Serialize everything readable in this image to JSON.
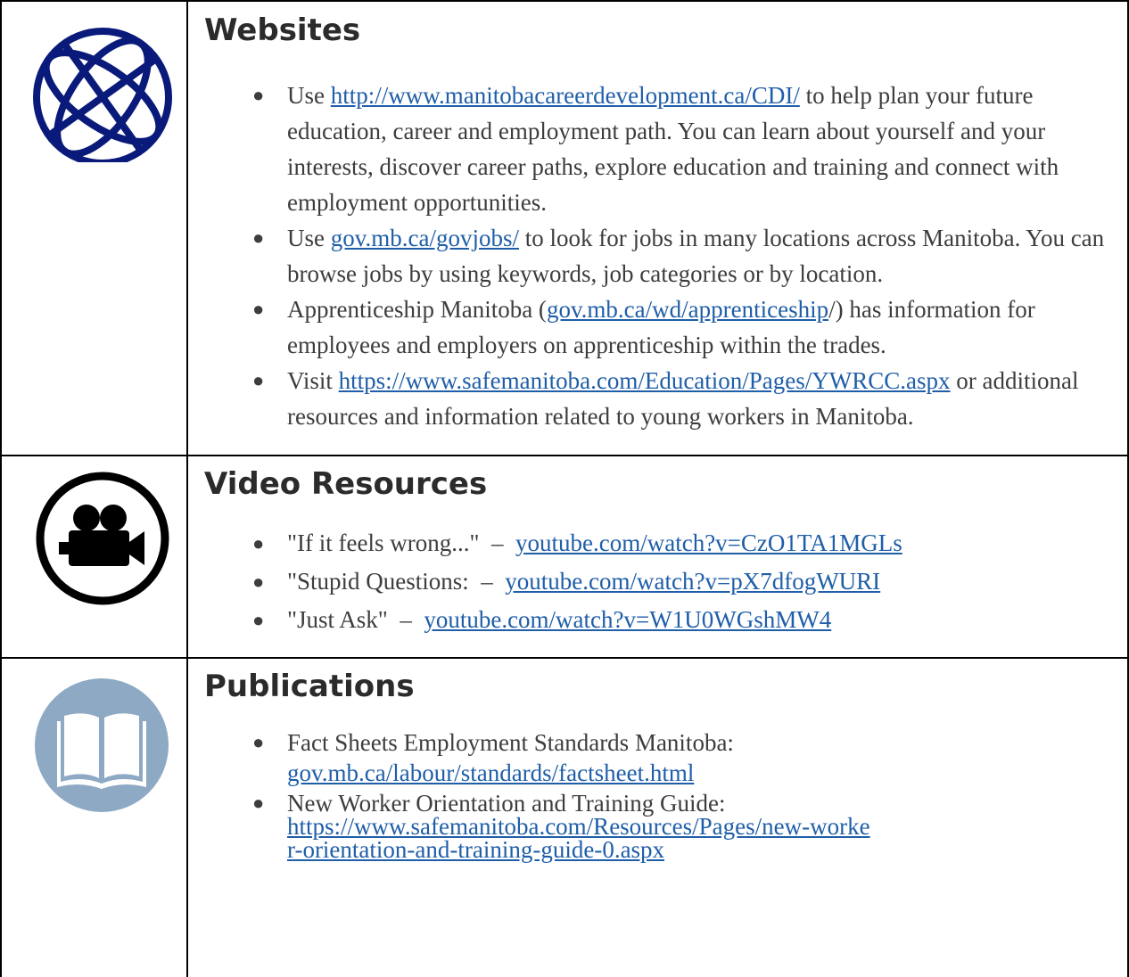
{
  "websites": {
    "title": "Websites",
    "items": [
      {
        "pre": "Use ",
        "link": "http://www.manitobacareerdevelopment.ca/CDI/",
        "post": " to help plan your future education, career and employment path. You can learn about yourself and your interests, discover career paths, explore education and training and connect with employment opportunities."
      },
      {
        "pre": "Use ",
        "link": "gov.mb.ca/govjobs/",
        "post": " to look for jobs in many locations across Manitoba. You can browse jobs by using keywords, job categories or by location."
      },
      {
        "pre": "Apprenticeship Manitoba (",
        "link": "gov.mb.ca/wd/apprenticeship",
        "post": "/) has information for employees and employers on apprenticeship within the trades."
      },
      {
        "pre": "Visit ",
        "link": "https://www.safemanitoba.com/Education/Pages/YWRCC.aspx",
        "post": " or additional resources and information related to young workers in Manitoba."
      }
    ]
  },
  "videos": {
    "title": "Video Resources",
    "items": [
      {
        "pre": "\"If it feels wrong...\"  –  ",
        "link": "youtube.com/watch?v=CzO1TA1MGLs"
      },
      {
        "pre": "\"Stupid Questions:  –  ",
        "link": "youtube.com/watch?v=pX7dfogWURI"
      },
      {
        "pre": "\"Just Ask\"  –  ",
        "link": "youtube.com/watch?v=W1U0WGshMW4"
      }
    ]
  },
  "publications": {
    "title": "Publications",
    "items": [
      {
        "pre": "Fact Sheets Employment Standards Manitoba:",
        "link": "gov.mb.ca/labour/standards/factsheet.html"
      },
      {
        "pre": "New Worker Orientation and Training Guide:",
        "link": "https://www.safemanitoba.com/Resources/Pages/new-worker-orientation-and-training-guide-0.aspx"
      }
    ]
  },
  "icons": {
    "globe": "globe-icon",
    "video": "video-camera-icon",
    "book": "open-book-icon",
    "globe_color": "#0a1a7a",
    "book_bg_color": "#8ea9c4"
  }
}
